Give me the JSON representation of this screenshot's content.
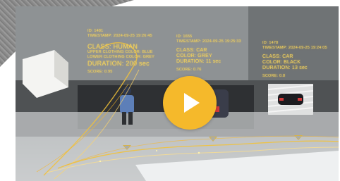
{
  "panels": [
    {
      "id_line": "ID: 1481",
      "timestamp_line": "TIMESTAMP: 2024-09-25 19:26:45",
      "class_line": "CLASS: HUMAN",
      "upper_line": "UPPER CLOTHING COLOR: BLUE",
      "lower_line": "LOWER CLOTHING COLOR:  GREY",
      "duration_line": "DURATION: 200 sec",
      "score_line": "SCORE: 0.95"
    },
    {
      "id_line": "ID: 1655",
      "timestamp_line": "TIMESTAMP: 2024-09-25 19:25:33",
      "class_line": "CLASS: CAR",
      "color_line": "COLOR: GREY",
      "duration_line": "DURATION: 11 sec",
      "score_line": "SCORE: 0.76"
    },
    {
      "id_line": "ID: 1478",
      "timestamp_line": "TIMESTAMP: 2024-09-25 19:24:05",
      "class_line": "CLASS: CAR",
      "color_line": "COLOR: BLACK",
      "duration_line": "DURATION: 13 sec",
      "score_line": "SCORE: 0.8"
    }
  ],
  "play_button": {
    "icon": "play-icon",
    "color": "#f5b92b"
  },
  "accent_color": "#f2d25c"
}
